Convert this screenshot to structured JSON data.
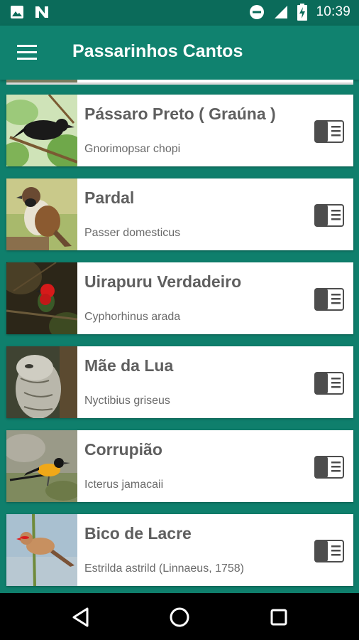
{
  "status_bar": {
    "time": "10:39",
    "left_icons": [
      "image-icon",
      "n-icon"
    ],
    "right_icons": [
      "do-not-disturb-icon",
      "signal-icon",
      "battery-charging-icon"
    ]
  },
  "app_bar": {
    "title": "Passarinhos Cantos",
    "menu_icon": "menu-icon"
  },
  "birds": [
    {
      "name": "Pássaro Preto ( Graúna )",
      "scientific": "Gnorimopsar chopi",
      "thumb": "black-bird-photo"
    },
    {
      "name": "Pardal",
      "scientific": "Passer domesticus",
      "thumb": "sparrow-photo"
    },
    {
      "name": "Uirapuru Verdadeiro",
      "scientific": "Cyphorhinus arada",
      "thumb": "red-bird-photo"
    },
    {
      "name": "Mãe da Lua",
      "scientific": "Nyctibius griseus",
      "thumb": "potoo-photo"
    },
    {
      "name": "Corrupião",
      "scientific": "Icterus jamacaii",
      "thumb": "oriole-photo"
    },
    {
      "name": "Bico de Lacre",
      "scientific": "Estrilda astrild (Linnaeus, 1758)",
      "thumb": "waxbill-photo"
    }
  ],
  "colors": {
    "background": "#0f7f6c",
    "app_bar": "#10826f",
    "status_bar": "#0b6b5a",
    "card": "#ffffff",
    "text": "#5f5f5f"
  },
  "nav_bar": {
    "icons": [
      "back-triangle-icon",
      "home-circle-icon",
      "recents-square-icon"
    ]
  }
}
